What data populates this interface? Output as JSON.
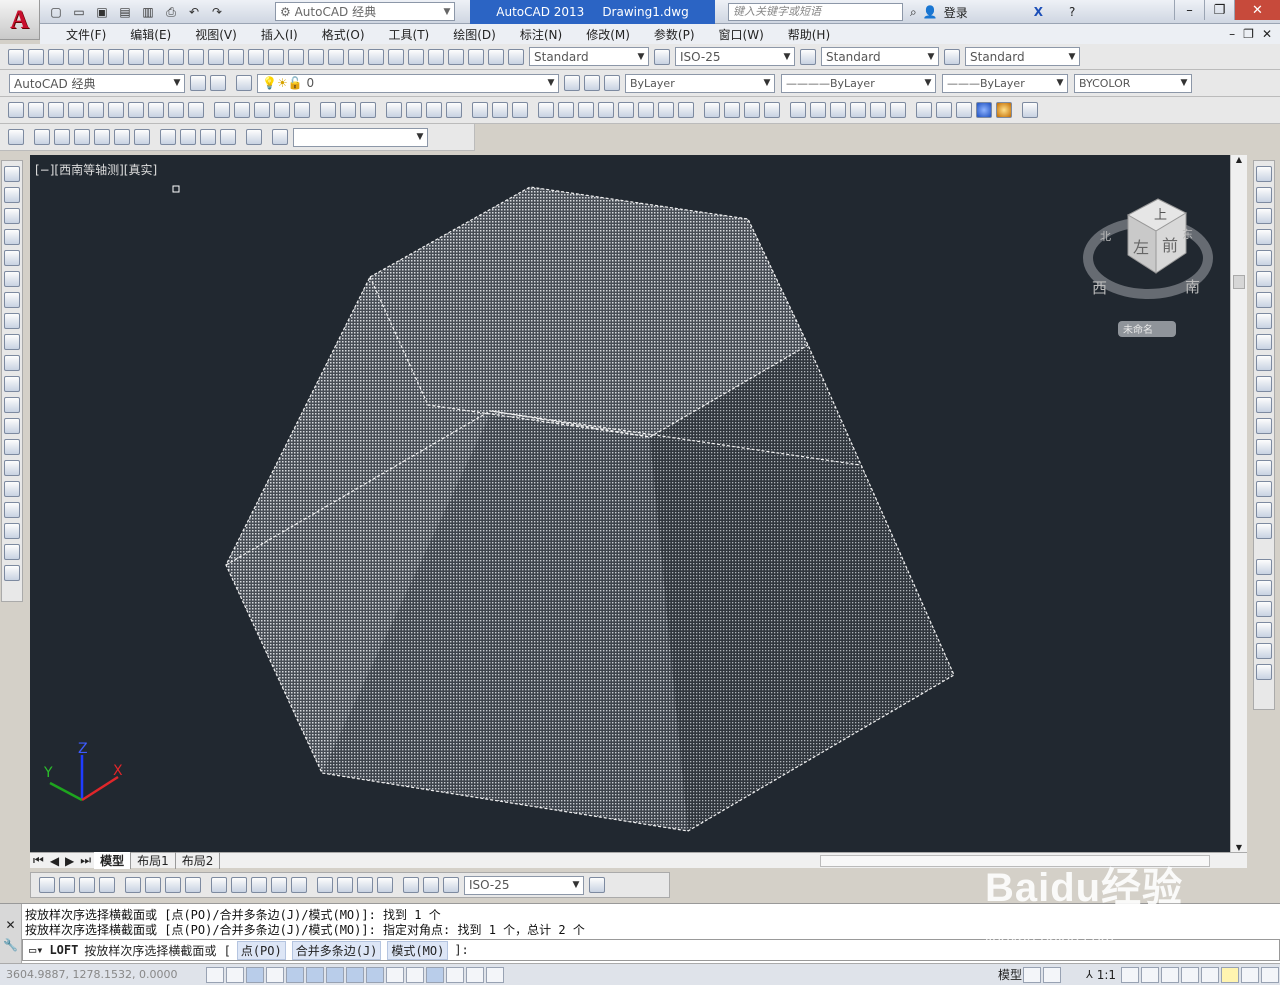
{
  "titlebar": {
    "workspace": "AutoCAD 经典",
    "app_name": "AutoCAD 2013",
    "doc_name": "Drawing1.dwg",
    "search_placeholder": "键入关键字或短语",
    "login_label": "登录"
  },
  "menubar": {
    "items": [
      "文件(F)",
      "编辑(E)",
      "视图(V)",
      "插入(I)",
      "格式(O)",
      "工具(T)",
      "绘图(D)",
      "标注(N)",
      "修改(M)",
      "参数(P)",
      "窗口(W)",
      "帮助(H)"
    ]
  },
  "styles": {
    "text_style": "Standard",
    "dim_style": "ISO-25",
    "table_style": "Standard",
    "mleader_style": "Standard"
  },
  "layers": {
    "workspace": "AutoCAD 经典",
    "current_layer": "0",
    "color": "ByLayer",
    "linetype": "ByLayer",
    "lineweight": "ByLayer",
    "plotstyle": "BYCOLOR"
  },
  "viewport": {
    "label": "[−][西南等轴测][真实]",
    "viewcube": {
      "top": "上",
      "left": "左",
      "front": "前",
      "west": "西",
      "south": "南",
      "north": "北",
      "east": "东",
      "wcs": "未命名"
    },
    "ucs": {
      "x": "X",
      "y": "Y",
      "z": "Z"
    }
  },
  "tabs": [
    "模型",
    "布局1",
    "布局2"
  ],
  "dimbar": {
    "dim_style": "ISO-25"
  },
  "command": {
    "history": [
      "按放样次序选择横截面或 [点(PO)/合并多条边(J)/模式(MO)]: 找到 1 个",
      "按放样次序选择横截面或 [点(PO)/合并多条边(J)/模式(MO)]: 指定对角点: 找到 1 个，总计 2 个"
    ],
    "cmd": "LOFT",
    "prompt": "按放样次序选择横截面或 [",
    "opt1": "点(PO)",
    "opt2": "合并多条边(J)",
    "opt3": "模式(MO)",
    "suffix": "]:"
  },
  "status": {
    "coords": "3604.9887, 1278.1532, 0.0000",
    "model_label": "模型",
    "scale": "1:1"
  },
  "watermark": {
    "brand": "Baidu经验",
    "url": "jingyan.baidu.com"
  },
  "colors": {
    "viewport_bg": "#212830",
    "title_active": "#2b64c4"
  }
}
